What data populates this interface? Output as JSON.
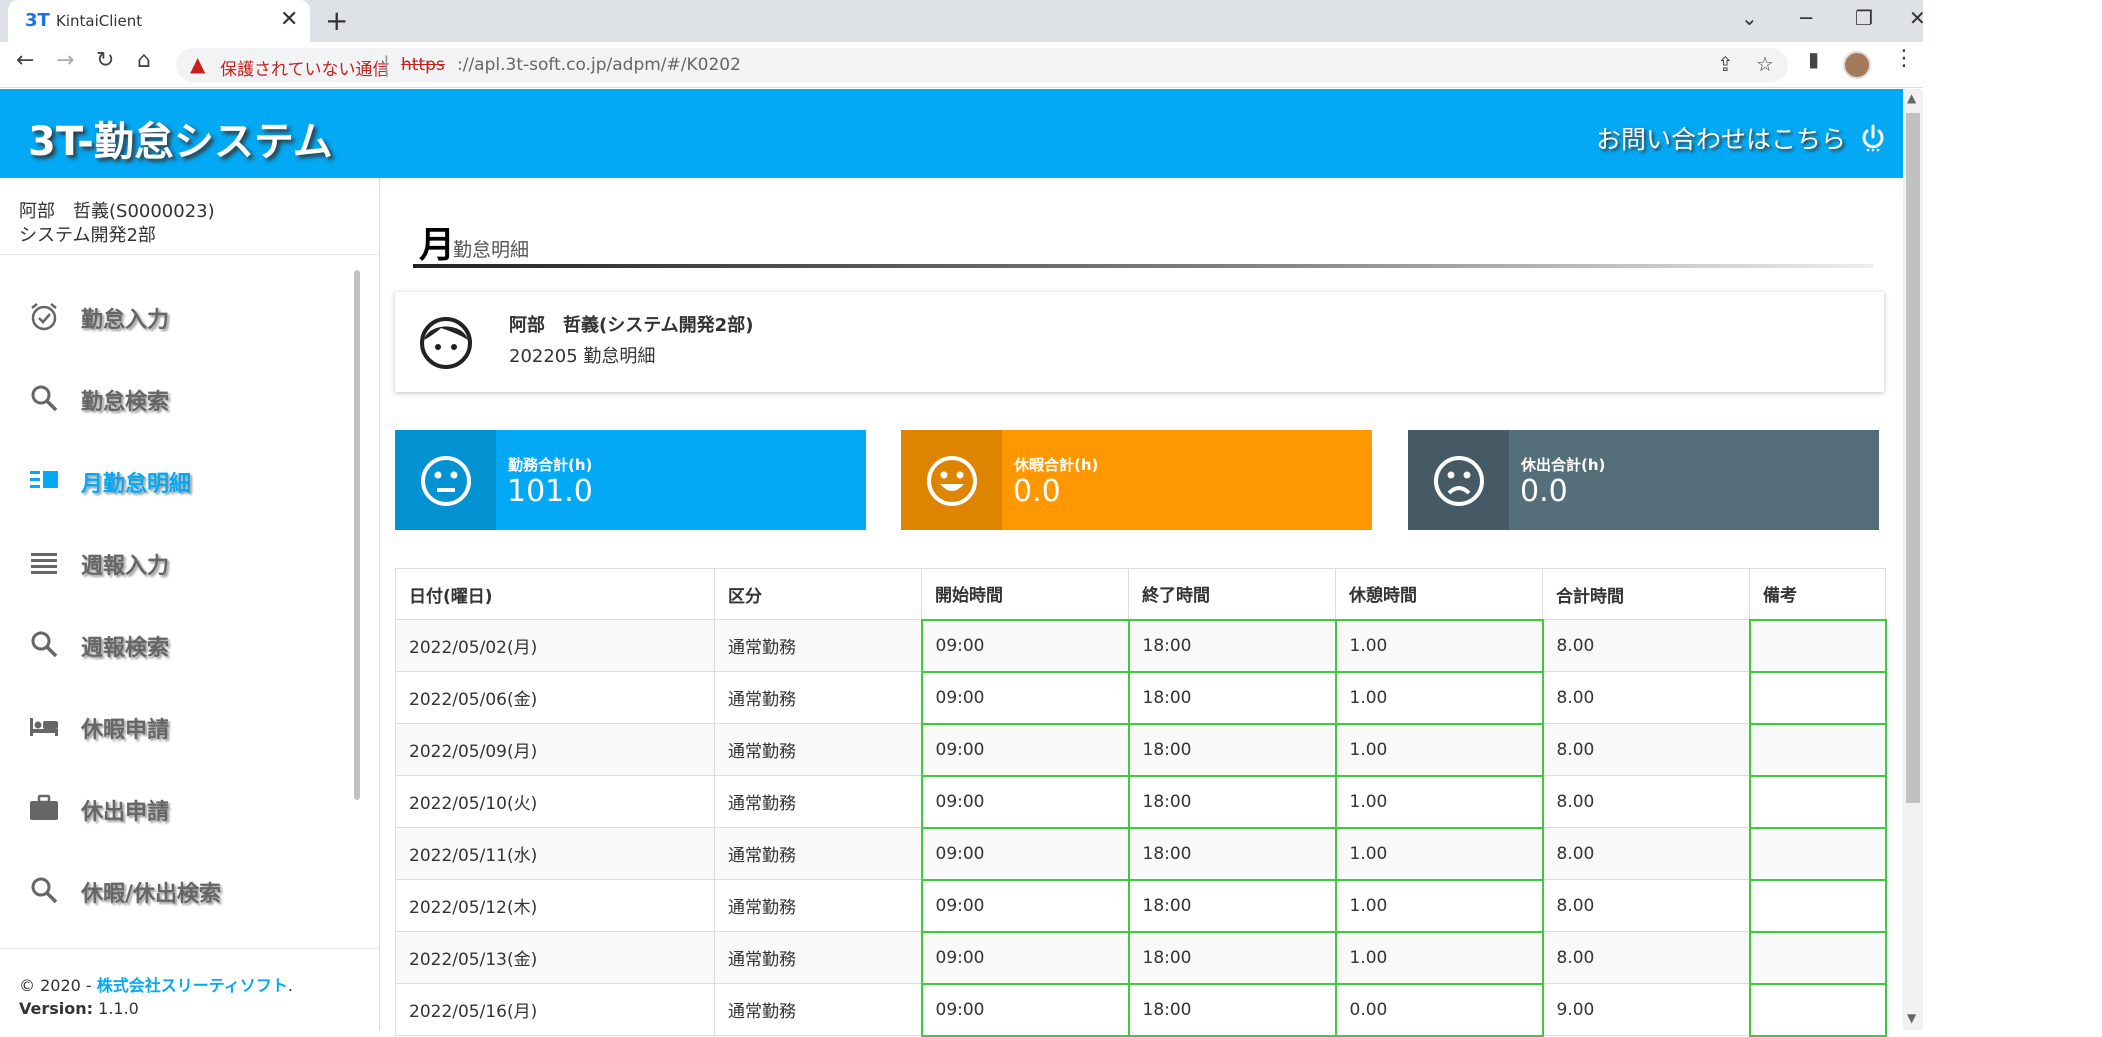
{
  "browser": {
    "tab_favicon": "3T",
    "tab_title": "KintaiClient",
    "tab_close": "✕",
    "new_tab": "+",
    "window_controls": {
      "chevron": "⌄",
      "minimize": "─",
      "restore": "❐",
      "close": "✕"
    },
    "security_warning": "保護されていない通信",
    "url_protocol": "https",
    "url_rest": "://apl.3t-soft.co.jp/adpm/#/K0202"
  },
  "header": {
    "brand": "3T-勤怠システム",
    "contact_prefix": "お問い合わせは",
    "contact_link": "こちら"
  },
  "user": {
    "name": "阿部　哲義(S0000023)",
    "dept": "システム開発2部"
  },
  "menu": [
    {
      "label": "勤怠入力",
      "icon": "alarm-check-icon"
    },
    {
      "label": "勤怠検索",
      "icon": "search-icon"
    },
    {
      "label": "月勤怠明細",
      "icon": "list-view-icon"
    },
    {
      "label": "週報入力",
      "icon": "lines-icon"
    },
    {
      "label": "週報検索",
      "icon": "search-icon"
    },
    {
      "label": "休暇申請",
      "icon": "bed-icon"
    },
    {
      "label": "休出申請",
      "icon": "briefcase-icon"
    },
    {
      "label": "休暇/休出検索",
      "icon": "search-icon"
    }
  ],
  "footer": {
    "copyright_prefix": "© 2020 - ",
    "company": "株式会社スリーティソフト",
    "copyright_suffix": ".",
    "version_label": "Version:",
    "version": " 1.1.0"
  },
  "page": {
    "title_big": "月",
    "title_small": "勤怠明細"
  },
  "profile": {
    "name": "阿部　哲義(システム開発2部)",
    "subtitle": "202205 勤怠明細"
  },
  "stats": [
    {
      "label": "勤務合計(h)",
      "value": "101.0",
      "color": "#03a9f4",
      "dark": "#0392d2",
      "face": "neutral"
    },
    {
      "label": "休暇合計(h)",
      "value": "0.0",
      "color": "#ff9800",
      "dark": "#dd8500",
      "face": "happy"
    },
    {
      "label": "休出合計(h)",
      "value": "0.0",
      "color": "#546e7a",
      "dark": "#455a64",
      "face": "sad"
    }
  ],
  "table": {
    "headers": [
      "日付(曜日)",
      "区分",
      "開始時間",
      "終了時間",
      "休憩時間",
      "合計時間",
      "備考"
    ],
    "rows": [
      [
        "2022/05/02(月)",
        "通常勤務",
        "09:00",
        "18:00",
        "1.00",
        "8.00",
        ""
      ],
      [
        "2022/05/06(金)",
        "通常勤務",
        "09:00",
        "18:00",
        "1.00",
        "8.00",
        ""
      ],
      [
        "2022/05/09(月)",
        "通常勤務",
        "09:00",
        "18:00",
        "1.00",
        "8.00",
        ""
      ],
      [
        "2022/05/10(火)",
        "通常勤務",
        "09:00",
        "18:00",
        "1.00",
        "8.00",
        ""
      ],
      [
        "2022/05/11(水)",
        "通常勤務",
        "09:00",
        "18:00",
        "1.00",
        "8.00",
        ""
      ],
      [
        "2022/05/12(木)",
        "通常勤務",
        "09:00",
        "18:00",
        "1.00",
        "8.00",
        ""
      ],
      [
        "2022/05/13(金)",
        "通常勤務",
        "09:00",
        "18:00",
        "1.00",
        "8.00",
        ""
      ],
      [
        "2022/05/16(月)",
        "通常勤務",
        "09:00",
        "18:00",
        "0.00",
        "9.00",
        ""
      ]
    ]
  }
}
